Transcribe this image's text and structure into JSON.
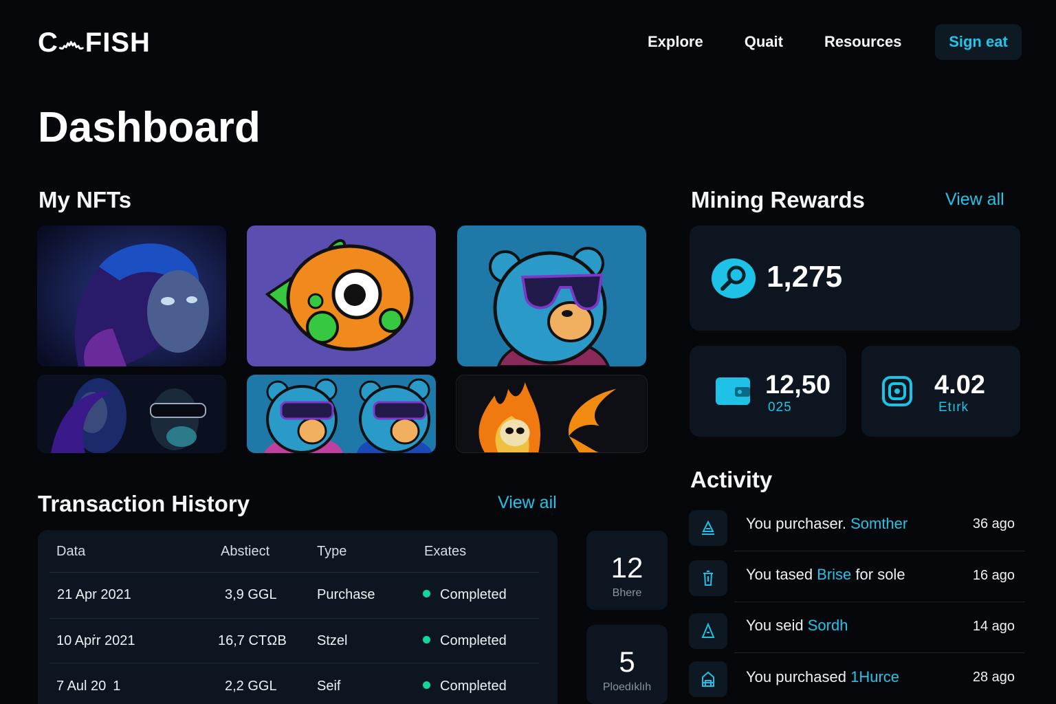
{
  "header": {
    "logo": "C෴FISH",
    "nav": [
      "Explore",
      "Quait",
      "Resources"
    ],
    "signin_label": "Sign eat"
  },
  "page_title": "Dashboard",
  "nfts": {
    "title": "My NFTs",
    "items": [
      "fantasy-woman",
      "orange-fish",
      "cool-bear",
      "woman-duo",
      "bear-duo",
      "fire-skull"
    ]
  },
  "mining": {
    "title": "Mining Rewards",
    "view_all": "View all",
    "main_value": "1,275",
    "stats": [
      {
        "value": "12,50",
        "sub": "025"
      },
      {
        "value": "4.02",
        "sub": "Etırk"
      }
    ]
  },
  "transactions": {
    "title": "Transaction History",
    "view_all": "View ail",
    "columns": [
      "Data",
      "Abstiect",
      "Type",
      "Exates"
    ],
    "rows": [
      {
        "date": "21 Apr 2021",
        "amount": "3,9 GGL",
        "type": "Purchase",
        "status": "Completed"
      },
      {
        "date": "10 Apṙr 2021",
        "amount": "16,7 CTΩB",
        "type": "Stzel",
        "status": "Completed"
      },
      {
        "date": "7 Aul 20 1",
        "amount": "2,2 GGL",
        "type": "Seif",
        "status": "Completed"
      }
    ]
  },
  "mini_stats": [
    {
      "value": "12",
      "label": "Bhere"
    },
    {
      "value": "5",
      "label": "Ploedıklıh"
    }
  ],
  "activity": {
    "title": "Activity",
    "items": [
      {
        "prefix": "You purchaser. ",
        "accent": "Somther",
        "suffix": "",
        "time": "36 ago"
      },
      {
        "prefix": "You tased ",
        "accent": "Brise",
        "suffix": " for sole",
        "time": "16 ago"
      },
      {
        "prefix": "You seid ",
        "accent": "Sordh",
        "suffix": "",
        "time": "14 ago"
      },
      {
        "prefix": "You purchased ",
        "accent": "1Hurce",
        "suffix": "",
        "time": "28 ago"
      }
    ]
  },
  "colors": {
    "accent": "#22c4e8",
    "background": "#05070b",
    "card": "#0d1620",
    "status": "#12d69b"
  }
}
